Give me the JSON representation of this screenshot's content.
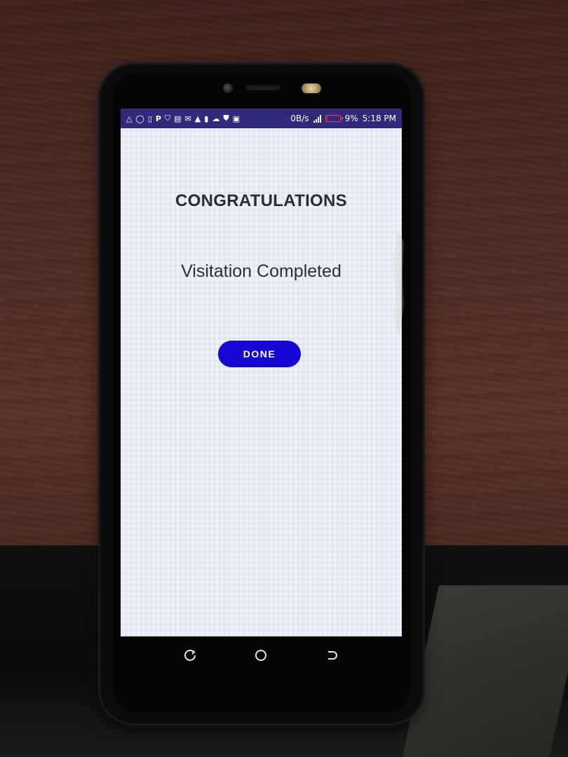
{
  "status_bar": {
    "data_rate": "0B/s",
    "battery_percent": "9%",
    "battery_level": 0.09,
    "time": "5:18 PM",
    "notification_icons": [
      "alert-triangle-icon",
      "chat-bubble-icon",
      "sim-icon",
      "p-icon",
      "shirt-icon",
      "image-icon",
      "mail-icon",
      "warning-icon",
      "phone-icon",
      "cloud-upload-icon",
      "shield-icon",
      "chart-icon"
    ],
    "colors": {
      "background": "#2f2a7a",
      "battery": "#ff3b3b"
    }
  },
  "main": {
    "headline": "CONGRATULATIONS",
    "subtitle": "Visitation Completed",
    "done_button_label": "DONE",
    "colors": {
      "button": "#1508d6",
      "text": "#2b2b30"
    }
  },
  "navigation": {
    "buttons": [
      "recent-apps-icon",
      "home-icon",
      "back-icon"
    ]
  }
}
